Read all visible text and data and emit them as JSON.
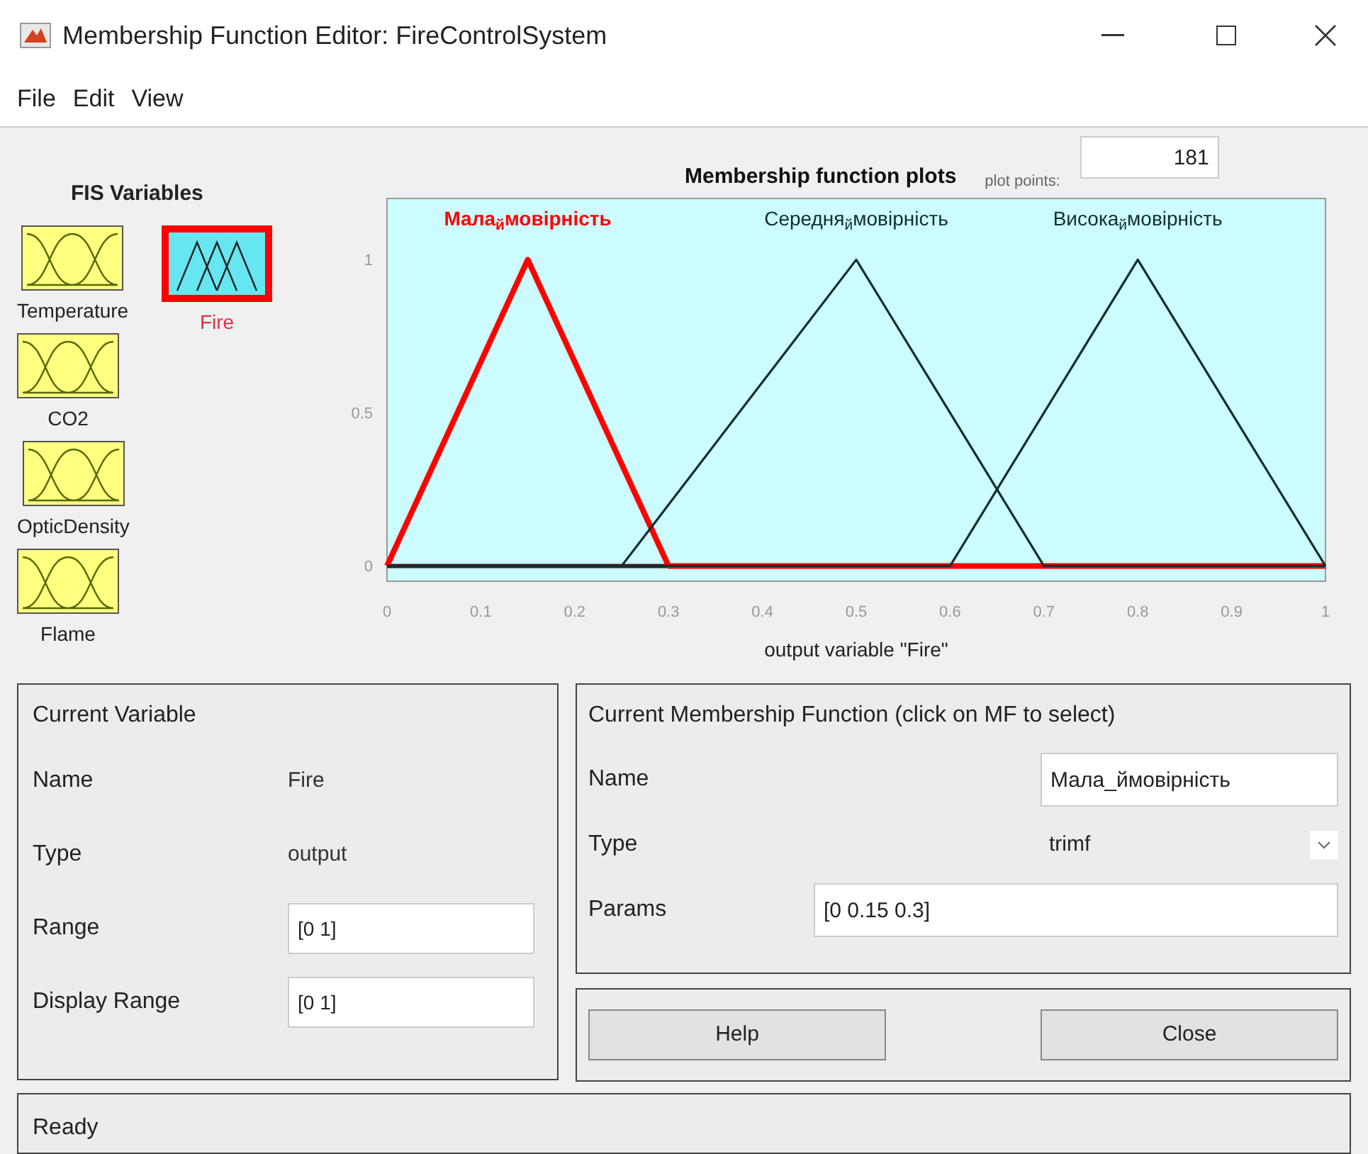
{
  "window": {
    "title": "Membership Function Editor: FireControlSystem"
  },
  "menu": [
    "File",
    "Edit",
    "View"
  ],
  "fis_variables": {
    "title": "FIS Variables",
    "items": [
      {
        "label": "Temperature",
        "kind": "input",
        "selected": false
      },
      {
        "label": "Fire",
        "kind": "output",
        "selected": true
      },
      {
        "label": "CO2",
        "kind": "input",
        "selected": false
      },
      {
        "label": "OpticDensity",
        "kind": "input",
        "selected": false
      },
      {
        "label": "Flame",
        "kind": "input",
        "selected": false
      }
    ]
  },
  "plot": {
    "plot_points_label": "plot points:",
    "plot_points": "181",
    "chart_data": {
      "type": "line",
      "title": "Membership function plots",
      "xlabel": "output variable \"Fire\"",
      "x": [
        0,
        0.15,
        0.25,
        0.3,
        0.5,
        0.6,
        0.7,
        0.8,
        1
      ],
      "series": [
        {
          "name": "Мала$_{й}$мовірність",
          "color": "#ff0000",
          "values": [
            0,
            1,
            0.333,
            0,
            0,
            0,
            0,
            0,
            0
          ]
        },
        {
          "name": "Середня$_{й}$мовірність",
          "color": "#0f2f2f",
          "values": [
            0,
            0,
            0,
            0.2,
            1,
            0.5,
            0,
            0,
            0
          ]
        },
        {
          "name": "Висока$_{й}$мовірність",
          "color": "#0f2f2f",
          "values": [
            0,
            0,
            0,
            0,
            0,
            0,
            0.5,
            1,
            0
          ]
        }
      ],
      "xlim": [
        0,
        1
      ],
      "ylim": [
        -0.05,
        1.2
      ],
      "xticks": [
        0,
        0.1,
        0.2,
        0.3,
        0.4,
        0.5,
        0.6,
        0.7,
        0.8,
        0.9,
        1
      ],
      "yticks": [
        0,
        0.5,
        1
      ]
    }
  },
  "current_variable": {
    "title": "Current Variable",
    "name_label": "Name",
    "name": "Fire",
    "type_label": "Type",
    "type": "output",
    "range_label": "Range",
    "range": "[0 1]",
    "display_range_label": "Display Range",
    "display_range": "[0 1]"
  },
  "current_mf": {
    "title": "Current Membership Function (click on MF to select)",
    "name_label": "Name",
    "name": "Мала_ймовірність",
    "type_label": "Type",
    "type": "trimf",
    "params_label": "Params",
    "params": "[0 0.15 0.3]"
  },
  "buttons": [
    "Help",
    "Close"
  ],
  "status_bar": "Ready"
}
